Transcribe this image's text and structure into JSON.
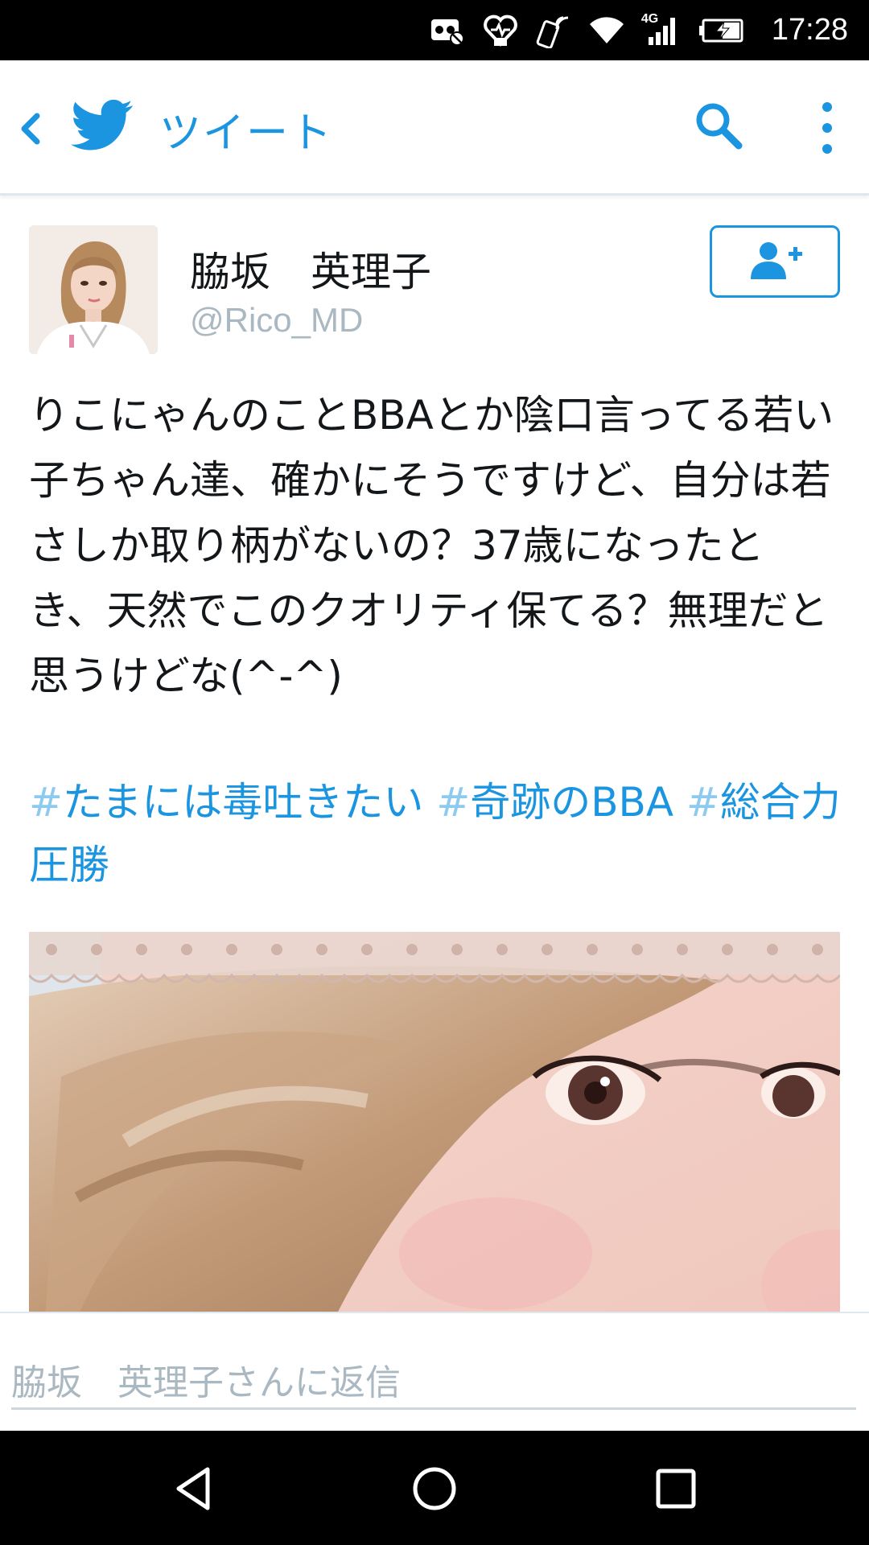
{
  "status_bar": {
    "network": "4G",
    "time": "17:28",
    "icons": [
      "voicemail-icon",
      "heart-monitor-icon",
      "phone-nfc-icon",
      "wifi-icon",
      "signal-icon",
      "battery-charging-icon"
    ]
  },
  "app_bar": {
    "title": "ツイート",
    "icons": [
      "back-chevron-icon",
      "twitter-bird-icon",
      "search-icon",
      "more-vert-icon"
    ]
  },
  "tweet": {
    "author_name": "脇坂　英理子",
    "handle": "@Rico_MD",
    "text": "りこにゃんのことBBAとか陰口言ってる若い子ちゃん達、確かにそうですけど、自分は若さしか取り柄がないの？37歳になったとき、天然でこのクオリティ保てる？無理だと思うけどな(^-^)",
    "hashtags": [
      {
        "hash": "#",
        "tag": "たまには毒吐きたい"
      },
      {
        "hash": "#",
        "tag": "奇跡のBBA"
      },
      {
        "hash": "#",
        "tag": "総合力圧勝"
      }
    ]
  },
  "reply": {
    "placeholder": "脇坂　英理子さんに返信"
  },
  "nav_bar": {
    "icons": [
      "back-triangle-icon",
      "home-circle-icon",
      "recents-square-icon"
    ]
  },
  "colors": {
    "accent": "#1b95e0",
    "hashtag_symbol": "#8ccaf0",
    "text": "#14171a",
    "muted": "#aab8c2"
  }
}
